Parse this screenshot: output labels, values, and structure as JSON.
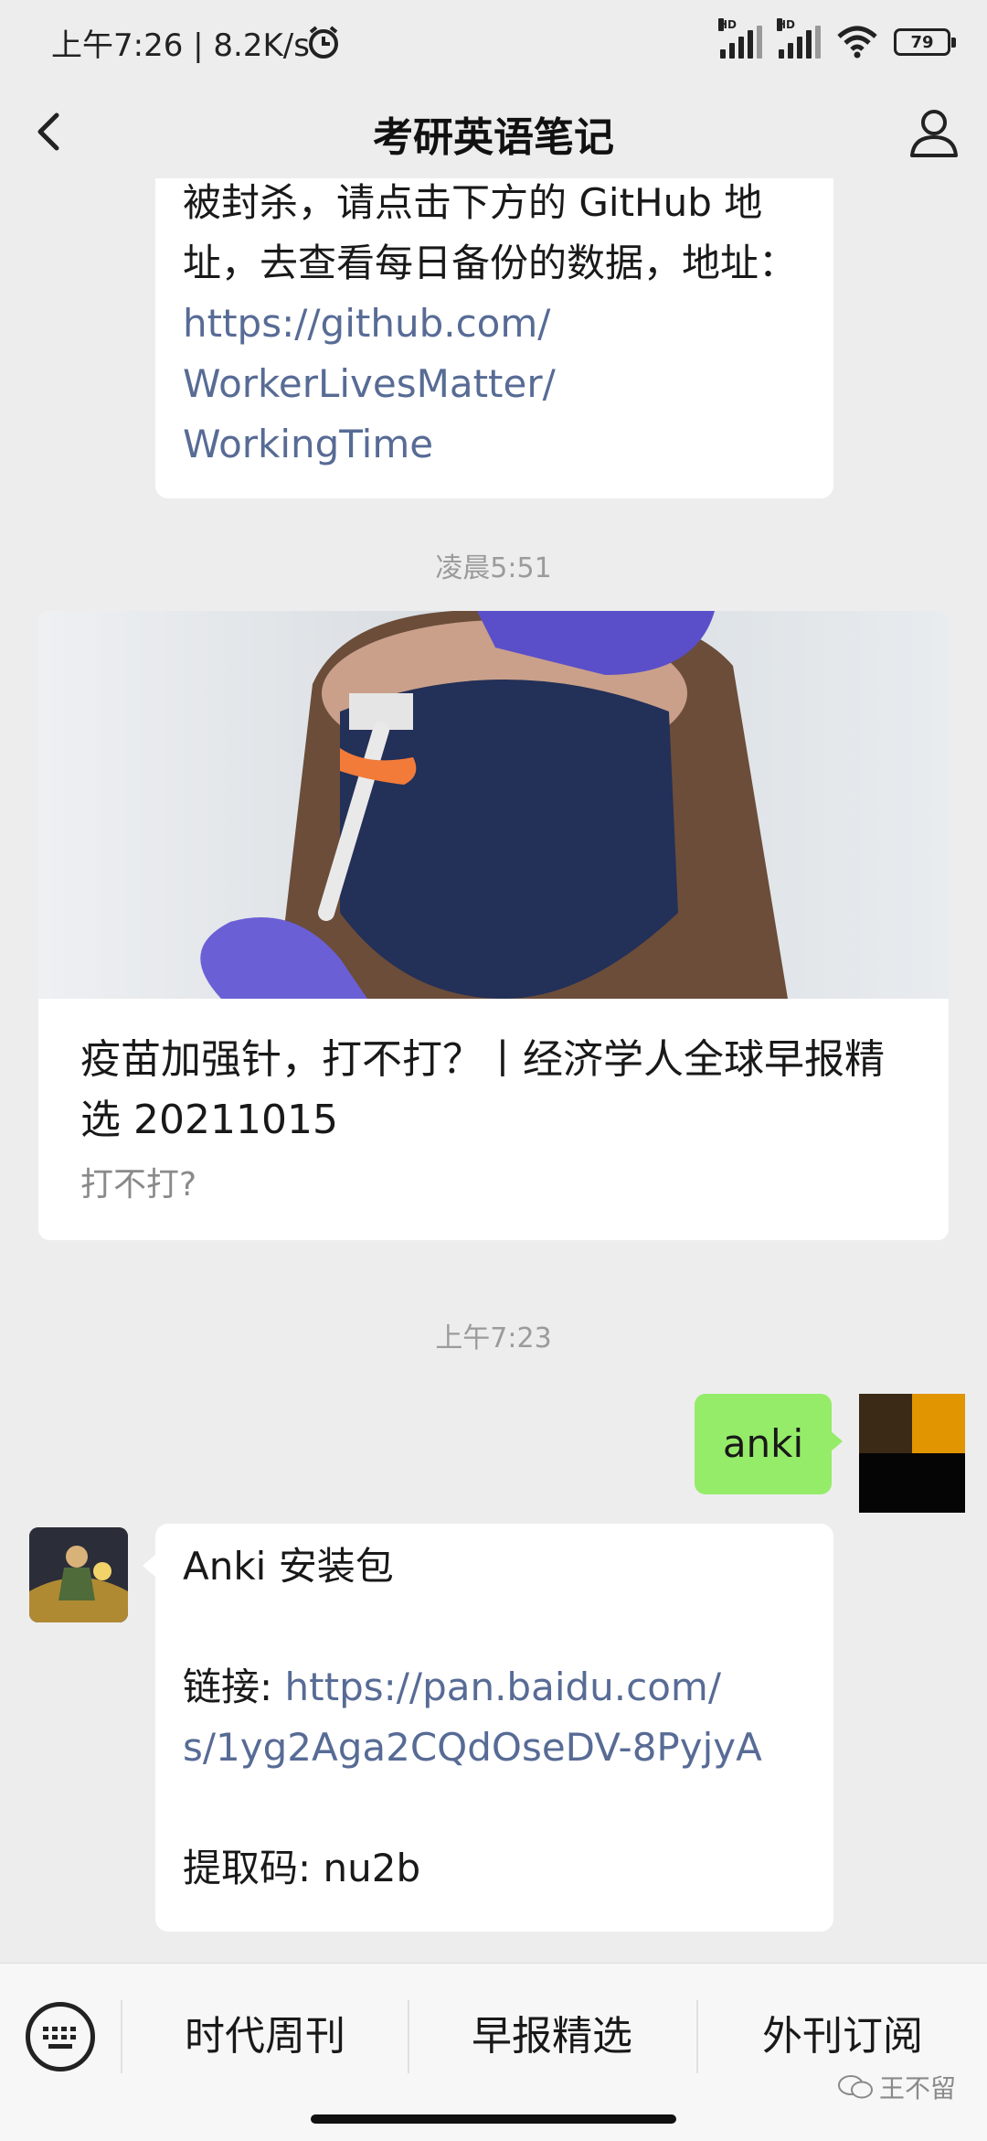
{
  "status_bar": {
    "time_speed": "上午7:26 | 8.2K/s",
    "alarm_icon": "alarm-clock-icon",
    "signal1_label": "HD",
    "signal2_label": "HD",
    "battery": "79"
  },
  "header": {
    "title": "考研英语笔记",
    "back_icon": "chevron-left-icon",
    "profile_icon": "person-icon"
  },
  "messages": {
    "first": {
      "line1": "被封杀，请点击下方的 GitHub 地",
      "line2": "址，去查看每日备份的数据，地址：",
      "link_line1": "https://github.com/",
      "link_line2": "WorkerLivesMatter/",
      "link_line3": "WorkingTime"
    },
    "ts1": "凌晨5:51",
    "article": {
      "title": "疫苗加强针，打不打？丨经济学人全球早报精选 20211015",
      "subtitle": "打不打?"
    },
    "ts2": "上午7:23",
    "sent": {
      "text": "anki"
    },
    "reply": {
      "line1": "Anki 安装包",
      "link_label": "链接: ",
      "link_line1": "https://pan.baidu.com/",
      "link_line2": "s/1yg2Aga2CQdOseDV-8PyjyA",
      "code": "提取码: nu2b"
    }
  },
  "bottom_menu": {
    "keyboard_icon": "keyboard-icon",
    "items": [
      "时代周刊",
      "早报精选",
      "外刊订阅"
    ]
  },
  "watermark": "王不留",
  "colors": {
    "background": "#ededed",
    "sent_bubble": "#95ec69",
    "link": "#576b95"
  }
}
